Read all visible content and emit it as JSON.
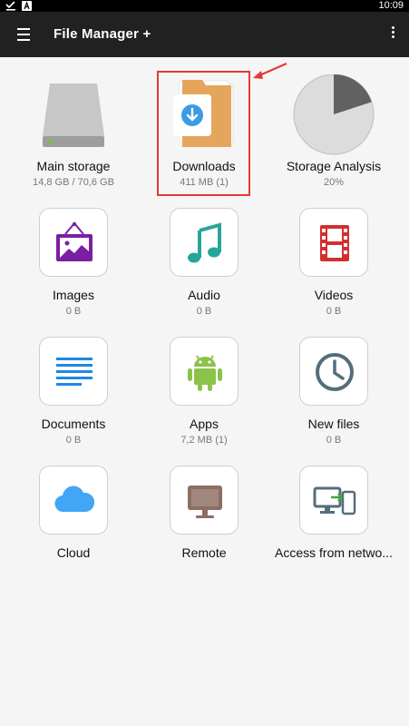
{
  "status_bar": {
    "time": "10:09"
  },
  "app_bar": {
    "title": "File Manager +"
  },
  "items": [
    {
      "label": "Main storage",
      "sub": "14,8 GB / 70,6 GB"
    },
    {
      "label": "Downloads",
      "sub": "411 MB (1)"
    },
    {
      "label": "Storage Analysis",
      "sub": "20%"
    },
    {
      "label": "Images",
      "sub": "0 B"
    },
    {
      "label": "Audio",
      "sub": "0 B"
    },
    {
      "label": "Videos",
      "sub": "0 B"
    },
    {
      "label": "Documents",
      "sub": "0 B"
    },
    {
      "label": "Apps",
      "sub": "7,2 MB (1)"
    },
    {
      "label": "New files",
      "sub": "0 B"
    },
    {
      "label": "Cloud"
    },
    {
      "label": "Remote"
    },
    {
      "label": "Access from netwo..."
    }
  ],
  "storage_analysis": {
    "used_percent": 20
  },
  "colors": {
    "accent_highlight": "#e53935",
    "app_bar": "#212121"
  }
}
